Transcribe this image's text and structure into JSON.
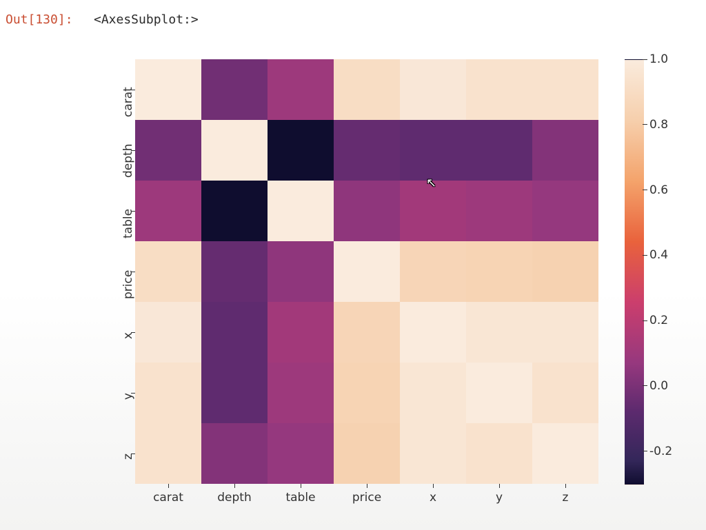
{
  "prompt": {
    "out_label": "Out[130]:"
  },
  "repr_text": "<AxesSubplot:>",
  "chart_data": {
    "type": "heatmap",
    "variables": [
      "carat",
      "depth",
      "table",
      "price",
      "x",
      "y",
      "z"
    ],
    "x_labels": [
      "carat",
      "depth",
      "table",
      "price",
      "x",
      "y",
      "z"
    ],
    "y_labels": [
      "carat",
      "depth",
      "table",
      "price",
      "x",
      "y",
      "z"
    ],
    "matrix": [
      [
        1.0,
        0.03,
        0.18,
        0.92,
        0.98,
        0.95,
        0.95
      ],
      [
        0.03,
        1.0,
        -0.3,
        -0.01,
        -0.03,
        -0.03,
        0.09
      ],
      [
        0.18,
        -0.3,
        1.0,
        0.13,
        0.2,
        0.18,
        0.15
      ],
      [
        0.92,
        -0.01,
        0.13,
        1.0,
        0.88,
        0.87,
        0.86
      ],
      [
        0.98,
        -0.03,
        0.2,
        0.88,
        1.0,
        0.97,
        0.97
      ],
      [
        0.95,
        -0.03,
        0.18,
        0.87,
        0.97,
        1.0,
        0.95
      ],
      [
        0.95,
        0.09,
        0.15,
        0.86,
        0.97,
        0.95,
        1.0
      ]
    ],
    "vmin": -0.3,
    "vmax": 1.0,
    "colorbar_ticks": [
      "1.0",
      "0.8",
      "0.6",
      "0.4",
      "0.2",
      "0.0",
      "-0.2"
    ],
    "cmap_stops": [
      {
        "t": 0.0,
        "color": "#0f0d2f"
      },
      {
        "t": 0.05,
        "color": "#34275a"
      },
      {
        "t": 0.2,
        "color": "#5c2a6e"
      },
      {
        "t": 0.35,
        "color": "#96387e"
      },
      {
        "t": 0.5,
        "color": "#cb3e6d"
      },
      {
        "t": 0.62,
        "color": "#e9623c"
      },
      {
        "t": 0.75,
        "color": "#f4a36b"
      },
      {
        "t": 0.88,
        "color": "#f6cfac"
      },
      {
        "t": 1.0,
        "color": "#faebdd"
      }
    ]
  }
}
